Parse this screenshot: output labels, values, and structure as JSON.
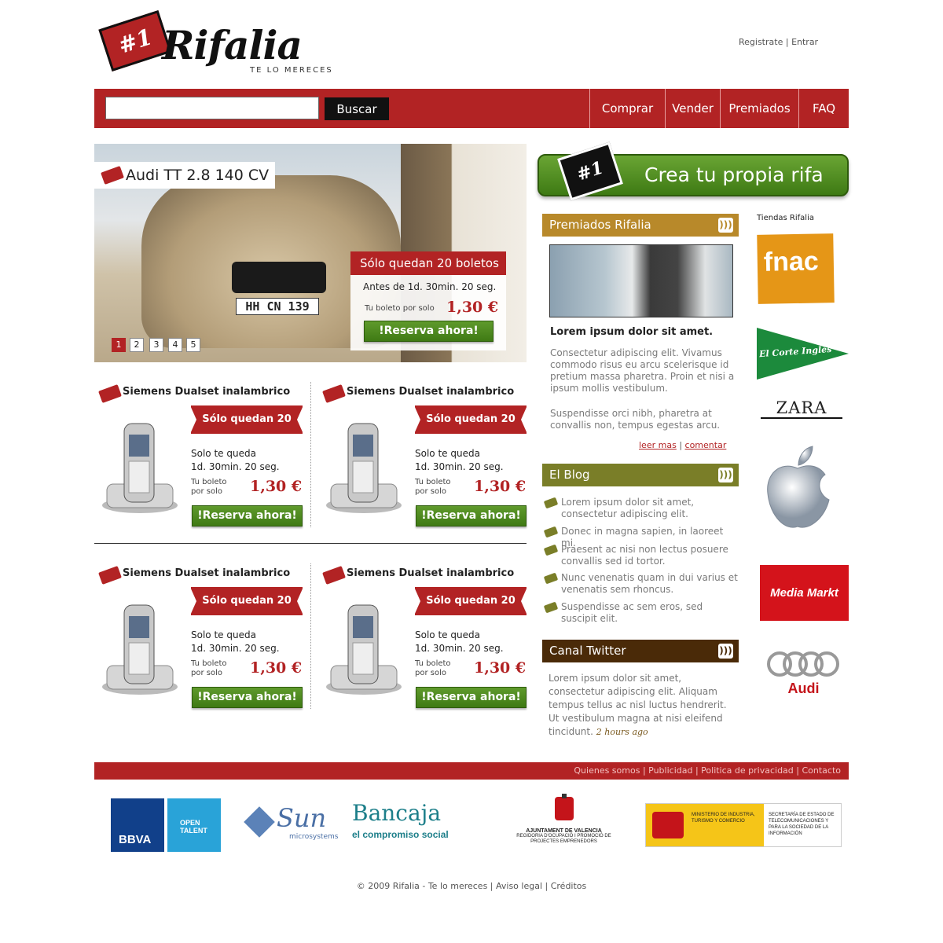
{
  "brand": {
    "name": "Rifalia",
    "tagline": "TE LO MERECES",
    "badge": "#1"
  },
  "top_links": {
    "register": "Registrate",
    "separator": "|",
    "login": "Entrar"
  },
  "nav": {
    "search_button": "Buscar",
    "search_value": "",
    "items": [
      "Comprar",
      "Vender",
      "Premiados",
      "FAQ"
    ]
  },
  "hero": {
    "title": "Audi TT 2.8 140 CV",
    "remaining": "Sólo quedan 20 boletos",
    "time": "Antes de 1d. 30min. 20 seg.",
    "ticket_label": "Tu boleto por solo",
    "price": "1,30 €",
    "button": "!Reserva ahora!",
    "plate": "HH CN 139",
    "pages": [
      "1",
      "2",
      "3",
      "4",
      "5"
    ],
    "active_page": "1"
  },
  "products": [
    {
      "title": "Siemens Dualset inalambrico",
      "remaining": "Sólo quedan 20",
      "queue_label": "Solo te queda",
      "time": "1d. 30min. 20 seg.",
      "ticket_label1": "Tu boleto",
      "ticket_label2": "por solo",
      "price": "1,30 €",
      "button": "!Reserva ahora!"
    },
    {
      "title": "Siemens Dualset inalambrico",
      "remaining": "Sólo quedan 20",
      "queue_label": "Solo te queda",
      "time": "1d. 30min. 20 seg.",
      "ticket_label1": "Tu boleto",
      "ticket_label2": "por solo",
      "price": "1,30 €",
      "button": "!Reserva ahora!"
    },
    {
      "title": "Siemens Dualset inalambrico",
      "remaining": "Sólo quedan 20",
      "queue_label": "Solo te queda",
      "time": "1d. 30min. 20 seg.",
      "ticket_label1": "Tu boleto",
      "ticket_label2": "por solo",
      "price": "1,30 €",
      "button": "!Reserva ahora!"
    },
    {
      "title": "Siemens Dualset inalambrico",
      "remaining": "Sólo quedan 20",
      "queue_label": "Solo te queda",
      "time": "1d. 30min. 20 seg.",
      "ticket_label1": "Tu boleto",
      "ticket_label2": "por solo",
      "price": "1,30 €",
      "button": "!Reserva ahora!"
    }
  ],
  "crea": {
    "label": "Crea tu propia rifa",
    "badge": "#1"
  },
  "premiados": {
    "title": "Premiados Rifalia",
    "heading": "Lorem ipsum dolor sit amet.",
    "p1": "Consectetur adipiscing elit. Vivamus commodo risus eu arcu scelerisque id pretium massa pharetra. Proin et nisi a ipsum mollis vestibulum.",
    "p2": "Suspendisse orci nibh, pharetra at convallis non, tempus egestas arcu.",
    "read_more": "leer mas",
    "separator": "|",
    "comment": "comentar"
  },
  "blog": {
    "title": "El Blog",
    "items": [
      "Lorem ipsum dolor sit amet, consectetur adipiscing elit.",
      "Donec in magna sapien, in laoreet mi.",
      "Praesent ac nisi non lectus posuere convallis sed id tortor.",
      "Nunc venenatis quam in dui varius et venenatis sem rhoncus.",
      "Suspendisse ac sem eros, sed suscipit elit."
    ]
  },
  "twitter": {
    "title": "Canal Twitter",
    "text": "Lorem ipsum dolor sit amet, consectetur adipiscing elit. Aliquam tempus tellus ac nisl luctus hendrerit. Ut vestibulum magna at nisi eleifend tincidunt.",
    "time": "2 hours ago"
  },
  "shops": {
    "title": "Tiendas Rifalia",
    "names": [
      "fnac",
      "El Corte Inglés",
      "ZARA",
      "Apple",
      "Media Markt",
      "Audi"
    ]
  },
  "footer": {
    "links": "Quienes somos | Publicidad | Politica de privacidad | Contacto",
    "sponsors": {
      "bbva": "BBVA",
      "open_talent": "OPEN TALENT",
      "sun": "Sun",
      "sun_sub": "microsystems",
      "bancaja": "Bancaja",
      "bancaja_sub": "el compromiso social",
      "ajuntament": "AJUNTAMENT DE VALENCIA",
      "ajuntament_sub": "REGIDORIA D'OCUPACIÓ I PROMOCIÓ DE PROJECTES EMPRENEDORS",
      "ministerio": "MINISTERIO DE INDUSTRIA, TURISMO Y COMERCIO",
      "secretaria": "SECRETARÍA DE ESTADO DE TELECOMUNICACIONES Y PARA LA SOCIEDAD DE LA INFORMACIÓN"
    },
    "copyright": "© 2009 Rifalia - Te lo mereces | Aviso legal | Créditos"
  },
  "colors": {
    "brand_red": "#b22324",
    "green": "#4a8a1c",
    "olive": "#7a7e28",
    "gold": "#b8892a",
    "brown": "#4a2a08"
  }
}
